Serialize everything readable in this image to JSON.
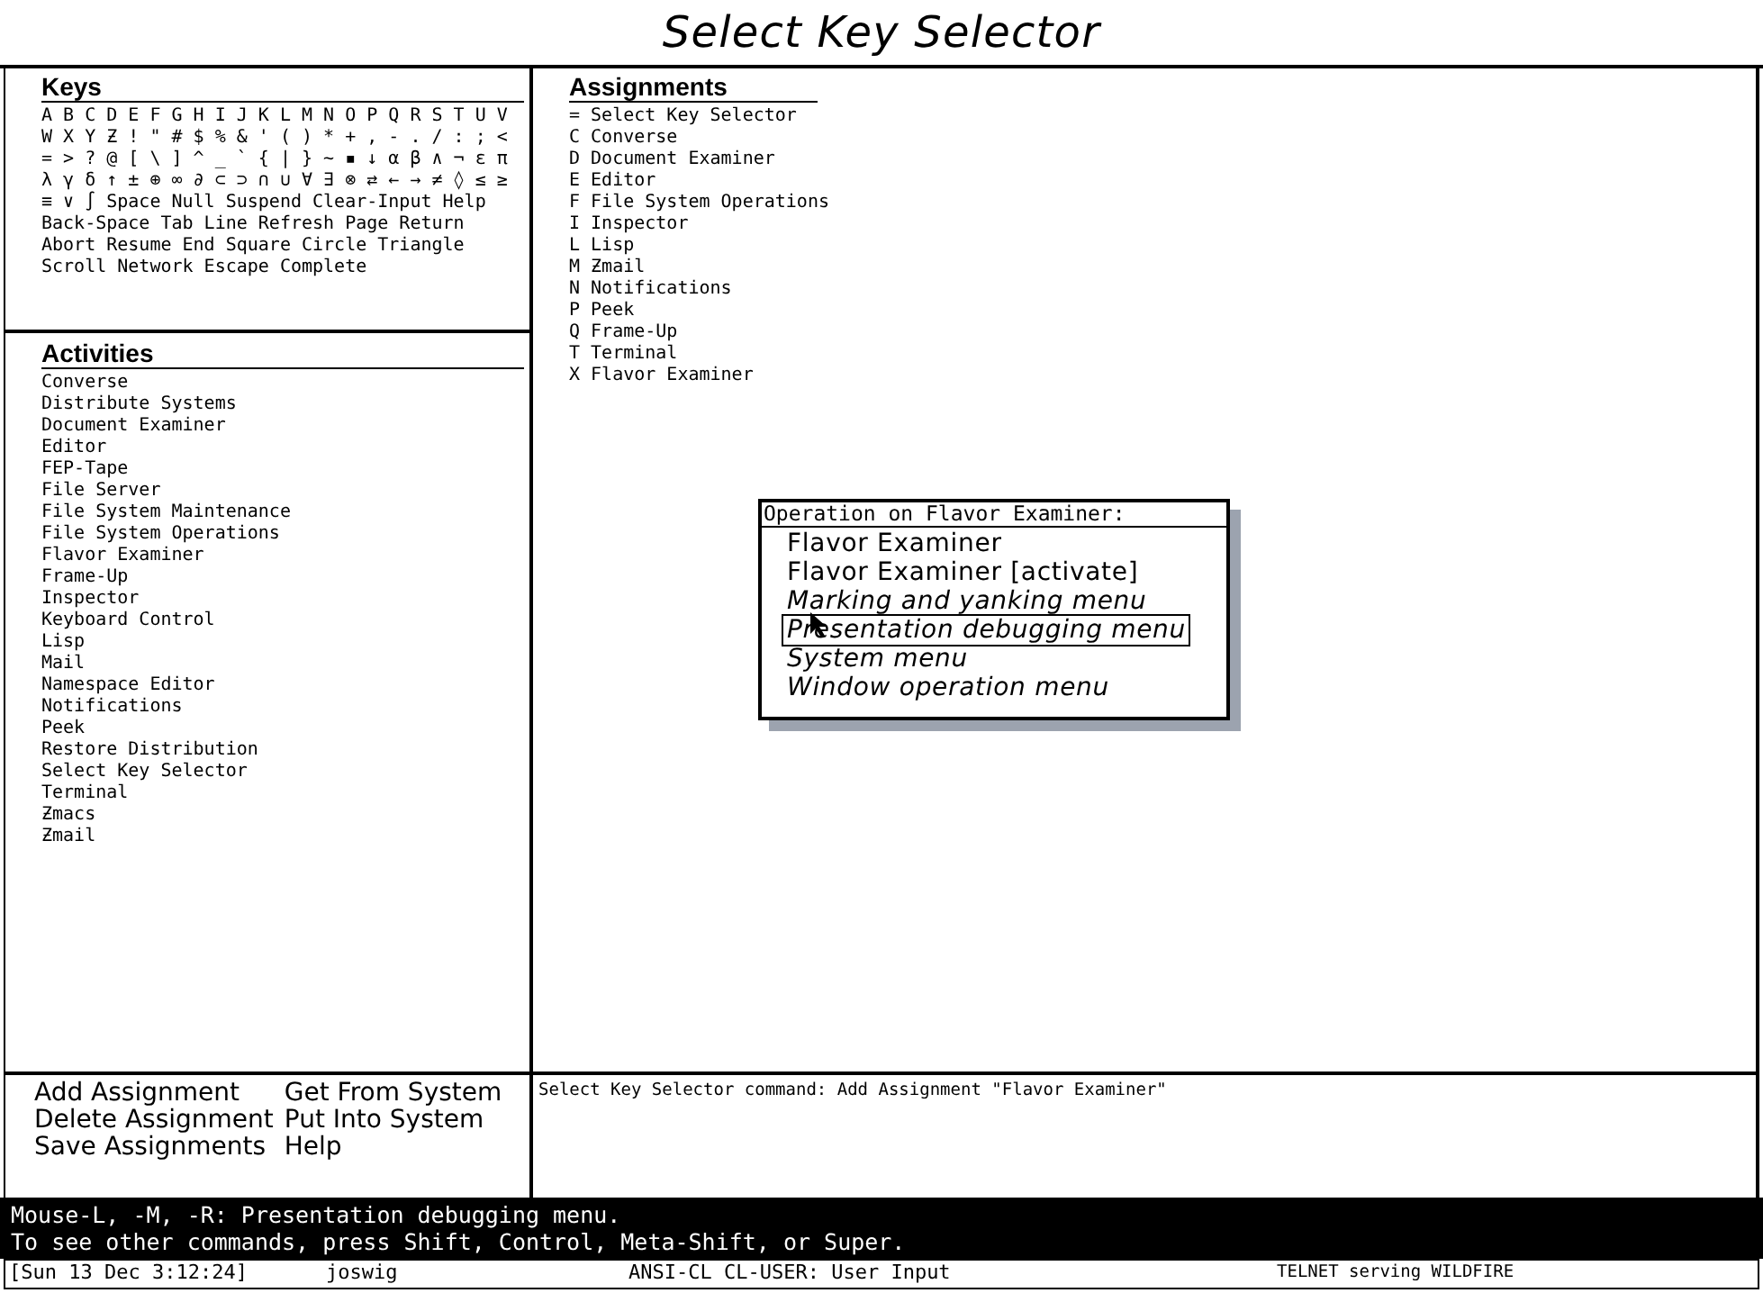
{
  "window": {
    "title": "Select Key Selector"
  },
  "keys": {
    "title": "Keys",
    "rows": [
      "A B C D E F G H I J K L M N O P Q R S T U V",
      "W X Y Ƶ ! \" # $ % & ' ( ) * + , - . / : ; <",
      "= > ? @ [ \\ ] ^ _ ` { | } ~ ▪ ↓ α β ∧ ¬ ε π",
      "λ γ δ ↑ ± ⊕ ∞ ∂ ⊂ ⊃ ∩ ∪ ∀ ∃ ⊗ ⇄ ← → ≠ ◊ ≤ ≥",
      "≡ ∨ ∫ Space Null Suspend Clear-Input Help",
      "Back-Space Tab Line Refresh Page Return",
      "Abort Resume End Square Circle Triangle",
      "Scroll Network Escape Complete"
    ]
  },
  "activities": {
    "title": "Activities",
    "items": [
      "Converse",
      "Distribute Systems",
      "Document Examiner",
      "Editor",
      "FEP-Tape",
      "File Server",
      "File System Maintenance",
      "File System Operations",
      "Flavor Examiner",
      "Frame-Up",
      "Inspector",
      "Keyboard Control",
      "Lisp",
      "Mail",
      "Namespace Editor",
      "Notifications",
      "Peek",
      "Restore Distribution",
      "Select Key Selector",
      "Terminal",
      "Ƶmacs",
      "Ƶmail"
    ]
  },
  "assignments": {
    "title": "Assignments",
    "items": [
      {
        "key": "=",
        "activity": "Select Key Selector"
      },
      {
        "key": "C",
        "activity": "Converse"
      },
      {
        "key": "D",
        "activity": "Document Examiner"
      },
      {
        "key": "E",
        "activity": "Editor"
      },
      {
        "key": "F",
        "activity": "File System Operations"
      },
      {
        "key": "I",
        "activity": "Inspector"
      },
      {
        "key": "L",
        "activity": "Lisp"
      },
      {
        "key": "M",
        "activity": "Ƶmail"
      },
      {
        "key": "N",
        "activity": "Notifications"
      },
      {
        "key": "P",
        "activity": "Peek"
      },
      {
        "key": "Q",
        "activity": "Frame-Up"
      },
      {
        "key": "T",
        "activity": "Terminal"
      },
      {
        "key": "X",
        "activity": "Flavor Examiner"
      }
    ]
  },
  "popup_menu": {
    "title": "Operation on Flavor Examiner:",
    "items": [
      {
        "label": "Flavor Examiner",
        "kind": "command",
        "selected": false
      },
      {
        "label": "Flavor Examiner [activate]",
        "kind": "command",
        "selected": false
      },
      {
        "label": "Marking and yanking menu",
        "kind": "submenu",
        "selected": false
      },
      {
        "label": "Presentation debugging menu",
        "kind": "submenu",
        "selected": true
      },
      {
        "label": "System menu",
        "kind": "submenu",
        "selected": false
      },
      {
        "label": "Window operation menu",
        "kind": "submenu",
        "selected": false
      }
    ]
  },
  "command_menu": {
    "columns": [
      [
        "Add Assignment",
        "Delete Assignment",
        "Save Assignments"
      ],
      [
        "Get From System",
        "Put Into System",
        "Help"
      ]
    ]
  },
  "typeout": "Select Key Selector command: Add Assignment \"Flavor Examiner\"",
  "mouse_documentation": [
    "Mouse-L, -M, -R: Presentation debugging menu.",
    "To see other commands, press Shift, Control, Meta-Shift, or Super."
  ],
  "status_bar": {
    "time": "[Sun 13 Dec 3:12:24]",
    "user": "joswig",
    "package": "ANSI-CL CL-USER: User Input",
    "process": "TELNET serving WILDFIRE"
  }
}
